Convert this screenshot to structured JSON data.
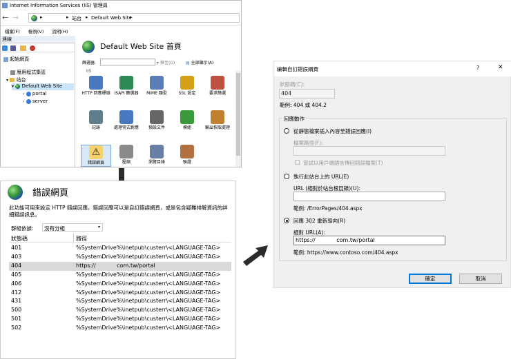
{
  "window": {
    "title": "Internet Information Services (IIS) 管理員",
    "address_path": [
      "站台",
      "Default Web Site"
    ]
  },
  "menubar": [
    "檔案(F)",
    "檢視(V)",
    "說明(H)"
  ],
  "connections": {
    "header": "連線",
    "tree": [
      {
        "label": "起始網頁",
        "indent": 0
      },
      {
        "label": "應用程式集區",
        "indent": 1
      },
      {
        "label": "站台",
        "indent": 1
      },
      {
        "label": "Default Web Site",
        "indent": 2
      },
      {
        "label": "portal",
        "indent": 3
      },
      {
        "label": "server",
        "indent": 3
      }
    ]
  },
  "main": {
    "title": "Default Web Site 首頁",
    "filter_label": "篩選器:",
    "go_label": "移至(G)",
    "show_all_label": "全部顯示(A)",
    "group_label": "IIS",
    "features": [
      {
        "label": "HTTP 回應標頭",
        "icon": "http-headers-icon",
        "color": "#4a78c0"
      },
      {
        "label": "ISAPI 篩選器",
        "icon": "isapi-filters-icon",
        "color": "#2e8b57"
      },
      {
        "label": "MIME 類型",
        "icon": "mime-types-icon",
        "color": "#5b7fb5"
      },
      {
        "label": "SSL 設定",
        "icon": "lock-icon",
        "color": "#d4a017"
      },
      {
        "label": "要求篩選",
        "icon": "request-filtering-icon",
        "color": "#c05040"
      },
      {
        "label": "記錄",
        "icon": "logging-icon",
        "color": "#607d8b"
      },
      {
        "label": "處理常式對應",
        "icon": "handler-mappings-icon",
        "color": "#4a78c0"
      },
      {
        "label": "預設文件",
        "icon": "default-document-icon",
        "color": "#666666"
      },
      {
        "label": "模組",
        "icon": "modules-icon",
        "color": "#3a9a3a"
      },
      {
        "label": "輸出快取處理",
        "icon": "output-caching-icon",
        "color": "#c08030"
      },
      {
        "label": "錯誤網頁",
        "icon": "warning-icon",
        "color": "#e0b000"
      },
      {
        "label": "壓縮",
        "icon": "compression-icon",
        "color": "#8a8a8a"
      },
      {
        "label": "瀏覽目錄",
        "icon": "directory-browsing-icon",
        "color": "#6a7fa8"
      },
      {
        "label": "驗證",
        "icon": "authentication-icon",
        "color": "#b07040"
      }
    ]
  },
  "error_pages": {
    "title": "錯誤網頁",
    "description": "此功能可用來設定 HTTP 錯誤回應。錯誤回應可以是自訂錯誤網頁，或是包含疑難排解資訊的詳細錯誤訊息。",
    "group_by_label": "群組依據:",
    "group_by_value": "沒有分組",
    "columns": [
      "狀態碼",
      "路徑"
    ],
    "rows": [
      {
        "code": "401",
        "path": "%SystemDrive%\\inetpub\\custerr\\<LANGUAGE-TAG>"
      },
      {
        "code": "403",
        "path": "%SystemDrive%\\inetpub\\custerr\\<LANGUAGE-TAG>"
      },
      {
        "code": "404",
        "path": "https://            com.tw/portal",
        "selected": true
      },
      {
        "code": "405",
        "path": "%SystemDrive%\\inetpub\\custerr\\<LANGUAGE-TAG>"
      },
      {
        "code": "406",
        "path": "%SystemDrive%\\inetpub\\custerr\\<LANGUAGE-TAG>"
      },
      {
        "code": "412",
        "path": "%SystemDrive%\\inetpub\\custerr\\<LANGUAGE-TAG>"
      },
      {
        "code": "431",
        "path": "%SystemDrive%\\inetpub\\custerr\\<LANGUAGE-TAG>"
      },
      {
        "code": "500",
        "path": "%SystemDrive%\\inetpub\\custerr\\<LANGUAGE-TAG>"
      },
      {
        "code": "501",
        "path": "%SystemDrive%\\inetpub\\custerr\\<LANGUAGE-TAG>"
      },
      {
        "code": "502",
        "path": "%SystemDrive%\\inetpub\\custerr\\<LANGUAGE-TAG>"
      }
    ]
  },
  "dialog": {
    "title": "編輯自訂錯誤網頁",
    "help": "?",
    "close": "✕",
    "status_label": "狀態碼(C):",
    "status_value": "404",
    "status_example": "範例: 404 或 404.2",
    "response_group": "回應動作",
    "opt1_label": "從靜態檔案插入內容至錯誤回應(I)",
    "opt1_path_label": "檔案路徑(F):",
    "opt1_path_value": "",
    "opt1_checkbox": "嘗試以用戶端語言傳回錯誤檔案(T)",
    "opt2_label": "執行此站台上的 URL(E)",
    "opt2_url_label": "URL (相對於站台根目錄)(U):",
    "opt2_url_value": "",
    "opt2_example": "範例: /ErrorPages/404.aspx",
    "opt3_label": "回應 302 重新導向(R)",
    "opt3_url_label": "絕對 URL(A):",
    "opt3_url_value": "https://            com.tw/portal",
    "opt3_example": "範例: https://www.contoso.com/404.aspx",
    "ok": "確定",
    "cancel": "取消"
  }
}
